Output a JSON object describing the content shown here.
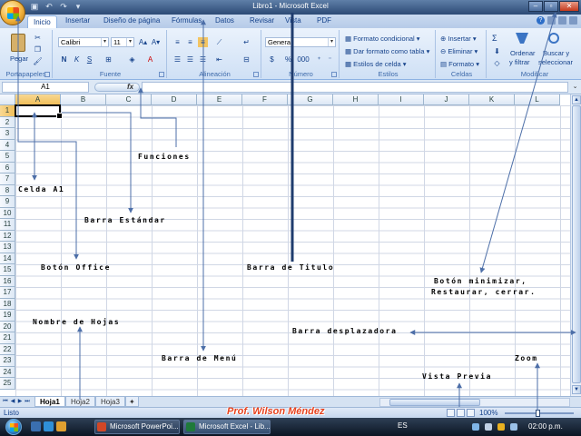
{
  "window": {
    "title": "Libro1 - Microsoft Excel",
    "controls": [
      "minimize-icon",
      "restore-icon",
      "close-icon"
    ]
  },
  "qat": [
    "save-icon",
    "undo-icon",
    "redo-icon",
    "customize-icon"
  ],
  "tabs": [
    "Inicio",
    "Insertar",
    "Diseño de página",
    "Fórmulas",
    "Datos",
    "Revisar",
    "Vista",
    "PDF"
  ],
  "ribbon": {
    "clipboard": {
      "paste": "Pegar",
      "label": "Portapapeles"
    },
    "font": {
      "family": "Calibri",
      "size": "11",
      "bold": "N",
      "italic": "K",
      "underline": "S",
      "label": "Fuente"
    },
    "alignment": {
      "label": "Alineación"
    },
    "number": {
      "format": "General",
      "currency": "$",
      "percent": "%",
      "thousands": "000",
      "label": "Número"
    },
    "styles": {
      "conditional": "Formato condicional",
      "table": "Dar formato como tabla",
      "cell": "Estilos de celda",
      "label": "Estilos"
    },
    "cells": {
      "insert": "Insertar",
      "delete": "Eliminar",
      "format": "Formato",
      "label": "Celdas"
    },
    "editing": {
      "sum": "Σ",
      "sort1": "Ordenar",
      "sort2": "y filtrar",
      "find1": "Buscar y",
      "find2": "seleccionar",
      "label": "Modificar"
    }
  },
  "formula": {
    "namebox": "A1",
    "fx": "fx",
    "content": ""
  },
  "grid": {
    "columns": [
      "A",
      "B",
      "C",
      "D",
      "E",
      "F",
      "G",
      "H",
      "I",
      "J",
      "K",
      "L"
    ],
    "rows": [
      "1",
      "2",
      "3",
      "4",
      "5",
      "6",
      "7",
      "8",
      "9",
      "10",
      "11",
      "12",
      "13",
      "14",
      "15",
      "16",
      "17",
      "18",
      "19",
      "20",
      "21",
      "22",
      "23",
      "24",
      "25"
    ],
    "selected": "A1"
  },
  "sheets": [
    "Hoja1",
    "Hoja2",
    "Hoja3"
  ],
  "status": {
    "text": "Listo",
    "zoom": "100%"
  },
  "taskbar": {
    "tasks": [
      "Microsoft PowerPoi...",
      "Microsoft Excel - Lib..."
    ],
    "lang": "ES",
    "clock": "02:00 p.m."
  },
  "annotations": {
    "funciones": "Funciones",
    "celda": "Celda A1",
    "barra_estandar": "Barra  Estándar",
    "boton_office": "Botón Office",
    "barra_titulo": "Barra  de  Titulo",
    "boton_min1": "Botón minimizar,",
    "boton_min2": "Restaurar, cerrar.",
    "nombre_hojas": "Nombre de Hojas",
    "barra_desplazadora": "Barra  desplazadora",
    "barra_menu": "Barra  de  Menú",
    "vista_previa": "Vista Previa",
    "zoom": "Zoom",
    "author": "Prof. Wilson Méndez"
  },
  "colors": {
    "accent": "#15428b",
    "selection": "#f1bf5a",
    "watermark": "#e8421e"
  }
}
